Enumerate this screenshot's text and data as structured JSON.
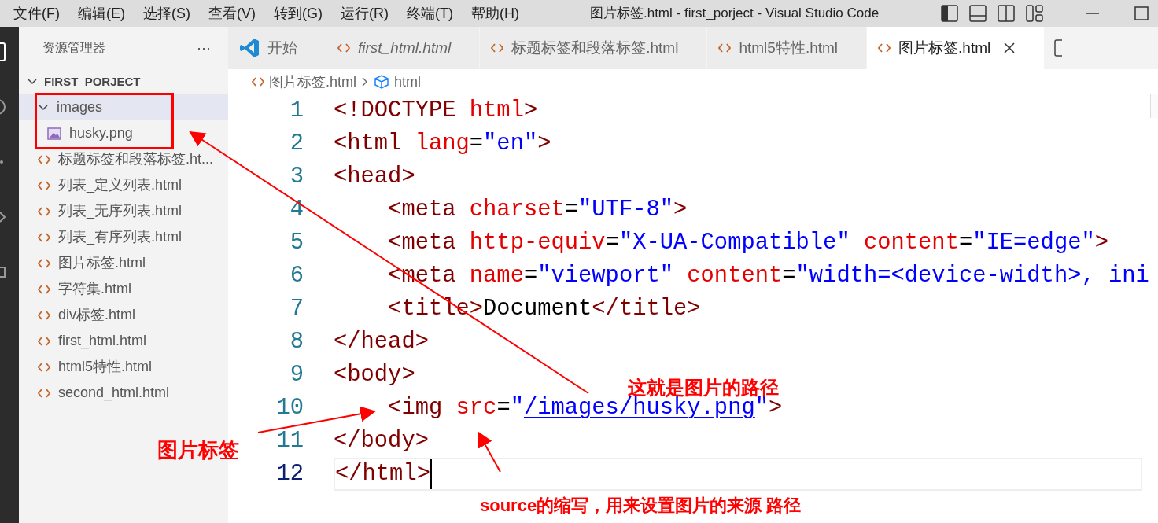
{
  "menu": [
    "文件(F)",
    "编辑(E)",
    "选择(S)",
    "查看(V)",
    "转到(G)",
    "运行(R)",
    "终端(T)",
    "帮助(H)"
  ],
  "window": {
    "title": "图片标签.html - first_porject - Visual Studio Code"
  },
  "sidebar": {
    "title": "资源管理器",
    "more": "···",
    "project": {
      "name": "FIRST_PORJECT",
      "expanded": true
    },
    "items": [
      {
        "label": "images",
        "kind": "folder",
        "expanded": true,
        "selected": true,
        "children": [
          {
            "label": "husky.png",
            "kind": "image",
            "selected": false
          }
        ]
      },
      {
        "label": "标题标签和段落标签.ht...",
        "kind": "html",
        "selected": false
      },
      {
        "label": "列表_定义列表.html",
        "kind": "html",
        "selected": false
      },
      {
        "label": "列表_无序列表.html",
        "kind": "html",
        "selected": false
      },
      {
        "label": "列表_有序列表.html",
        "kind": "html",
        "selected": false
      },
      {
        "label": "图片标签.html",
        "kind": "html",
        "selected": false
      },
      {
        "label": "字符集.html",
        "kind": "html",
        "selected": false
      },
      {
        "label": "div标签.html",
        "kind": "html",
        "selected": false
      },
      {
        "label": "first_html.html",
        "kind": "html",
        "selected": false
      },
      {
        "label": "html5特性.html",
        "kind": "html",
        "selected": false
      },
      {
        "label": "second_html.html",
        "kind": "html",
        "selected": false
      }
    ]
  },
  "tabs": [
    {
      "label": "开始",
      "kind": "welcome",
      "preview": false,
      "selected": false
    },
    {
      "label": "first_html.html",
      "kind": "html",
      "preview": true,
      "selected": false
    },
    {
      "label": "标题标签和段落标签.html",
      "kind": "html",
      "preview": false,
      "selected": false
    },
    {
      "label": "html5特性.html",
      "kind": "html",
      "preview": false,
      "selected": false
    },
    {
      "label": "图片标签.html",
      "kind": "html",
      "preview": false,
      "selected": true
    }
  ],
  "breadcrumb": [
    {
      "label": "图片标签.html",
      "kind": "file"
    },
    {
      "label": "html",
      "kind": "symbol"
    }
  ],
  "editor": {
    "lines": [
      {
        "number": "1",
        "current": false,
        "tokens": [
          {
            "kind": "tag",
            "text": "<!DOCTYPE"
          },
          {
            "kind": "attr",
            "text": " html"
          },
          {
            "kind": "tag",
            "text": ">"
          }
        ]
      },
      {
        "number": "2",
        "current": false,
        "tokens": [
          {
            "kind": "tag",
            "text": "<html"
          },
          {
            "kind": "attr",
            "text": " lang"
          },
          {
            "kind": "text",
            "text": "="
          },
          {
            "kind": "str",
            "text": "\"en\""
          },
          {
            "kind": "tag",
            "text": ">"
          }
        ]
      },
      {
        "number": "3",
        "current": false,
        "tokens": [
          {
            "kind": "tag",
            "text": "<head>"
          }
        ]
      },
      {
        "number": "4",
        "current": false,
        "tokens": [
          {
            "kind": "tag",
            "text": "    <meta"
          },
          {
            "kind": "attr",
            "text": " charset"
          },
          {
            "kind": "text",
            "text": "="
          },
          {
            "kind": "str",
            "text": "\"UTF-8\""
          },
          {
            "kind": "tag",
            "text": ">"
          }
        ]
      },
      {
        "number": "5",
        "current": false,
        "tokens": [
          {
            "kind": "tag",
            "text": "    <meta"
          },
          {
            "kind": "attr",
            "text": " http-equiv"
          },
          {
            "kind": "text",
            "text": "="
          },
          {
            "kind": "str",
            "text": "\"X-UA-Compatible\""
          },
          {
            "kind": "attr",
            "text": " content"
          },
          {
            "kind": "text",
            "text": "="
          },
          {
            "kind": "str",
            "text": "\"IE=edge\""
          },
          {
            "kind": "tag",
            "text": ">"
          }
        ]
      },
      {
        "number": "6",
        "current": false,
        "tokens": [
          {
            "kind": "tag",
            "text": "    <meta"
          },
          {
            "kind": "attr",
            "text": " name"
          },
          {
            "kind": "text",
            "text": "="
          },
          {
            "kind": "str",
            "text": "\"viewport\""
          },
          {
            "kind": "attr",
            "text": " content"
          },
          {
            "kind": "text",
            "text": "="
          },
          {
            "kind": "str",
            "text": "\"width=<device-width>, ini"
          }
        ]
      },
      {
        "number": "7",
        "current": false,
        "tokens": [
          {
            "kind": "tag",
            "text": "    <title>"
          },
          {
            "kind": "text",
            "text": "Document"
          },
          {
            "kind": "tag",
            "text": "</title>"
          }
        ]
      },
      {
        "number": "8",
        "current": false,
        "tokens": [
          {
            "kind": "tag",
            "text": "</head>"
          }
        ]
      },
      {
        "number": "9",
        "current": false,
        "tokens": [
          {
            "kind": "tag",
            "text": "<body>"
          }
        ]
      },
      {
        "number": "10",
        "current": false,
        "tokens": [
          {
            "kind": "tag",
            "text": "    <img"
          },
          {
            "kind": "attr",
            "text": " src"
          },
          {
            "kind": "text",
            "text": "="
          },
          {
            "kind": "str",
            "text": "\""
          },
          {
            "kind": "link",
            "text": "/images/husky.png"
          },
          {
            "kind": "str",
            "text": "\""
          },
          {
            "kind": "tag",
            "text": ">"
          }
        ]
      },
      {
        "number": "11",
        "current": false,
        "tokens": [
          {
            "kind": "tag",
            "text": "</body>"
          }
        ]
      },
      {
        "number": "12",
        "current": true,
        "tokens": [
          {
            "kind": "tag",
            "text": "</html>"
          }
        ]
      }
    ]
  },
  "annotations": [
    {
      "text": "这就是图片的路径"
    },
    {
      "text": "图片标签"
    },
    {
      "text": "source的缩写，用来设置图片的来源 路径"
    }
  ]
}
